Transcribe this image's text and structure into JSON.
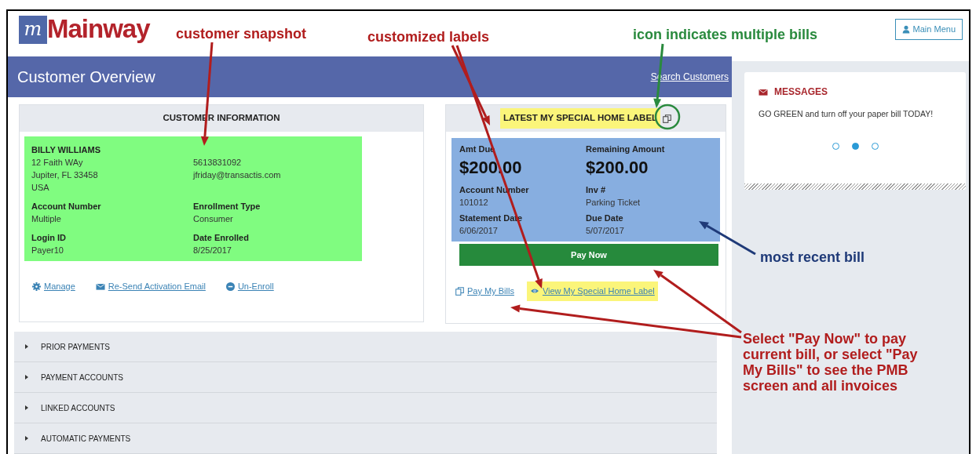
{
  "header": {
    "logo_mark": "m",
    "logo_text": "Mainway",
    "menu_button": "Main Menu"
  },
  "page_title": "Customer Overview",
  "search_link": "Search Customers",
  "customer_info": {
    "title": "CUSTOMER INFORMATION",
    "name": "BILLY WILLIAMS",
    "address": [
      "12 Faith WAy",
      "Jupiter, FL 33458",
      "USA"
    ],
    "contact": [
      "5613831092",
      "jfriday@transactis.com"
    ],
    "fields": [
      {
        "label": "Account Number",
        "value": "Multiple"
      },
      {
        "label": "Enrollment Type",
        "value": "Consumer"
      },
      {
        "label": "Login ID",
        "value": "Payer10"
      },
      {
        "label": "Date Enrolled",
        "value": "8/25/2017"
      }
    ],
    "actions": [
      {
        "kind": "gear",
        "label": "Manage"
      },
      {
        "kind": "envelope",
        "label": "Re-Send Activation Email"
      },
      {
        "kind": "minus",
        "label": "Un-Enroll"
      }
    ]
  },
  "latest_bill": {
    "title": "LATEST MY SPECIAL HOME LABEL",
    "highlighted": true,
    "multiple_bills": true,
    "amounts": [
      {
        "label": "Amt Due",
        "value": "$200.00"
      },
      {
        "label": "Remaining Amount",
        "value": "$200.00"
      }
    ],
    "fields": [
      {
        "label": "Account Number",
        "value": "101012"
      },
      {
        "label": "Inv #",
        "value": "Parking Ticket"
      },
      {
        "label": "Statement Date",
        "value": "6/06/2017"
      },
      {
        "label": "Due Date",
        "value": "5/07/2017"
      }
    ],
    "pay_button": "Pay Now",
    "links": [
      {
        "kind": "bills",
        "label": "Pay My Bills",
        "highlighted": false
      },
      {
        "kind": "eye",
        "label": "View My Special Home Label",
        "highlighted": true
      }
    ]
  },
  "sections": [
    {
      "label": "PRIOR PAYMENTS",
      "expanded": false
    },
    {
      "label": "PAYMENT ACCOUNTS",
      "expanded": false
    },
    {
      "label": "LINKED ACCOUNTS",
      "expanded": false
    },
    {
      "label": "AUTOMATIC PAYMENTS",
      "expanded": false
    }
  ],
  "messages": {
    "title": "MESSAGES",
    "text": "GO GREEN and turn off your paper bill TODAY!",
    "dots": [
      {
        "selected": false
      },
      {
        "selected": true
      },
      {
        "selected": false
      }
    ]
  },
  "annotations": [
    {
      "text": "customer snapshot",
      "color": "#b11d1d"
    },
    {
      "text": "customized labels",
      "color": "#b11d1d"
    },
    {
      "text": "icon indicates multiple bills",
      "color": "#2a8a3e"
    },
    {
      "text": "most recent bill",
      "color": "#1f3a78"
    },
    {
      "text": "Select \"Pay Now\" to pay\ncurrent bill, or select \"Pay\nMy Bills\" to see the PMB\nscreen and all invoices",
      "color": "#b11d1d"
    }
  ]
}
